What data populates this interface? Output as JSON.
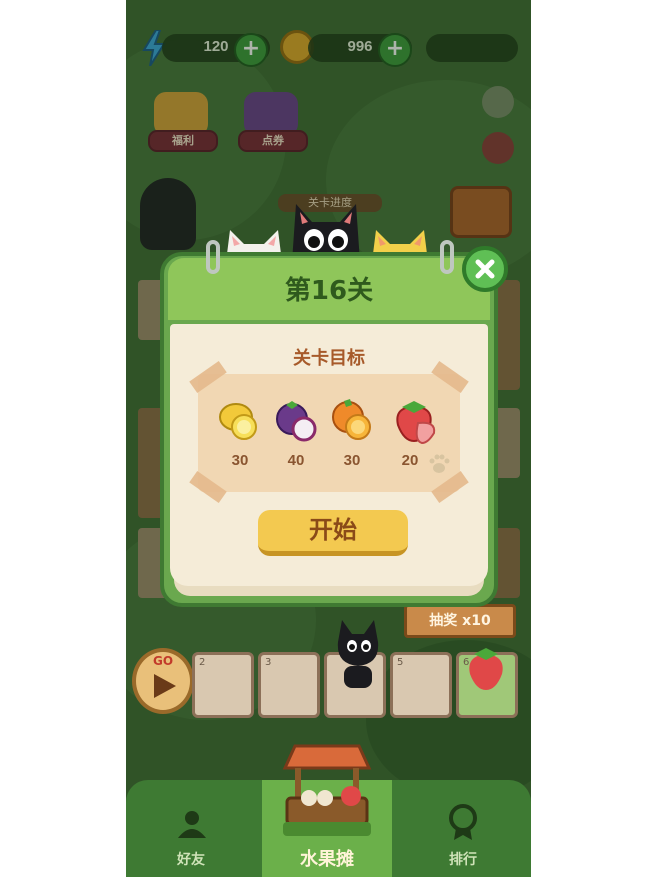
{
  "topbar": {
    "energy_value": "120",
    "coins_value": "996",
    "energy_plus": "+",
    "coins_plus": "+"
  },
  "icons": {
    "welfare_label": "福利",
    "voucher_label": "点券"
  },
  "progress": {
    "label": "关卡进度"
  },
  "popup": {
    "title": "第16关",
    "goal_title": "关卡目标",
    "start_label": "开始",
    "close_icon": "close-icon",
    "goals": [
      {
        "fruit": "lemon-icon",
        "count": "30"
      },
      {
        "fruit": "mangosteen-icon",
        "count": "40"
      },
      {
        "fruit": "orange-icon",
        "count": "30"
      },
      {
        "fruit": "strawberry-icon",
        "count": "20"
      }
    ]
  },
  "board": {
    "go_label": "GO",
    "tiles": [
      "2",
      "3",
      "5",
      "6"
    ],
    "draw_label": "抽奖 x10"
  },
  "nav": {
    "friends_label": "好友",
    "fruit_shop_label": "水果摊",
    "rank_label": "排行"
  },
  "colors": {
    "bg_green": "#3f6a35",
    "popup_green": "#6aa84e",
    "header_green": "#8fc65a",
    "paper": "#f5ecd8",
    "start_yellow": "#f3c950"
  }
}
